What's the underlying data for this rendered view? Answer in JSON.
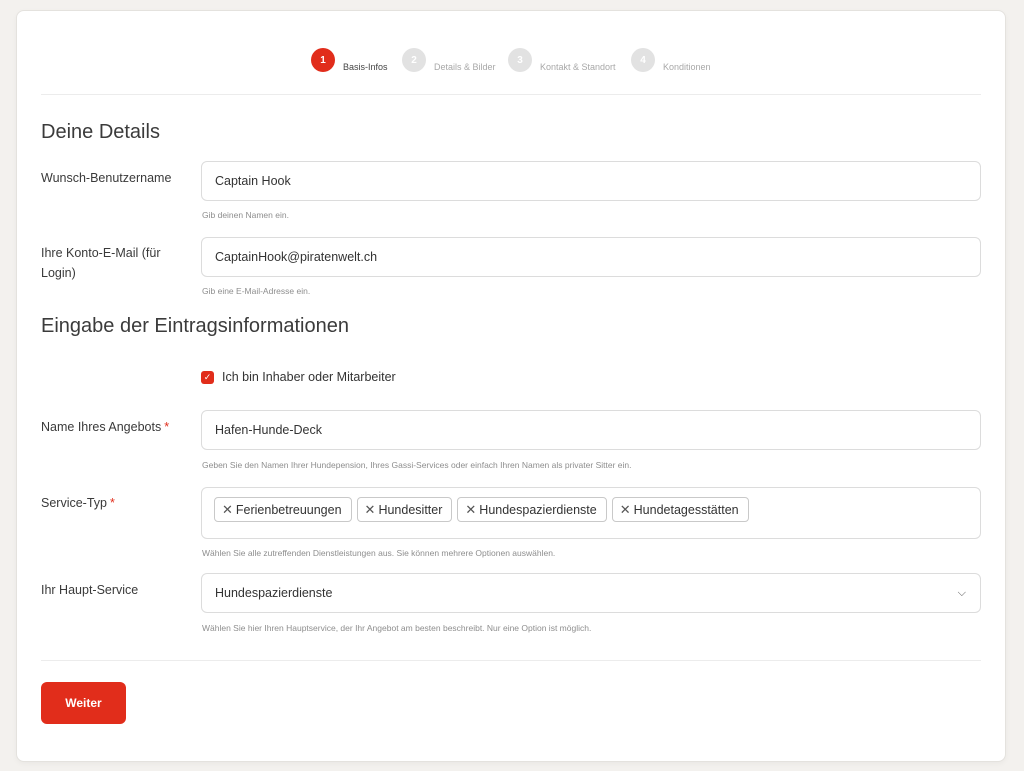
{
  "stepper": {
    "steps": [
      {
        "num": "1",
        "label": "Basis-Infos"
      },
      {
        "num": "2",
        "label": "Details & Bilder"
      },
      {
        "num": "3",
        "label": "Kontakt & Standort"
      },
      {
        "num": "4",
        "label": "Konditionen"
      }
    ],
    "active_step": 1
  },
  "details": {
    "heading": "Deine Details",
    "username": {
      "label": "Wunsch-Benutzername",
      "value": "Captain Hook",
      "help": "Gib deinen Namen ein."
    },
    "email": {
      "label": "Ihre Konto-E-Mail (für Login)",
      "value": "CaptainHook@piratenwelt.ch",
      "help": "Gib eine E-Mail-Adresse ein."
    }
  },
  "listing": {
    "heading": "Eingabe der Eintragsinformationen",
    "owner_checkbox": {
      "label": "Ich bin Inhaber oder Mitarbeiter",
      "checked": true
    },
    "offer_name": {
      "label": "Name Ihres Angebots",
      "required_mark": "*",
      "value": "Hafen-Hunde-Deck",
      "help": "Geben Sie den Namen Ihrer Hundepension, Ihres Gassi-Services oder einfach Ihren Namen als privater Sitter ein."
    },
    "service_type": {
      "label": "Service-Typ",
      "required_mark": "*",
      "tags": [
        "Ferienbetreuungen",
        "Hundesitter",
        "Hundespazierdienste",
        "Hundetagesstätten"
      ],
      "help": "Wählen Sie alle zutreffenden Dienstleistungen aus. Sie können mehrere Optionen auswählen."
    },
    "main_service": {
      "label": "Ihr Haupt-Service",
      "value": "Hundespazierdienste",
      "help": "Wählen Sie hier Ihren Hauptservice, der Ihr Angebot am besten beschreibt. Nur eine Option ist möglich."
    }
  },
  "actions": {
    "next_label": "Weiter"
  },
  "colors": {
    "accent": "#e12d1b",
    "step_inactive": "#e2e2e2"
  },
  "icons": {
    "tag_remove": "close-icon",
    "select": "chevron-down-icon",
    "check": "check-icon"
  }
}
